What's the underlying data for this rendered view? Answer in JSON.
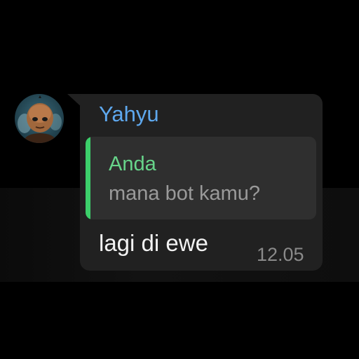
{
  "message": {
    "sender_name": "Yahyu",
    "avatar_icon": "profile-photo-icon",
    "reply": {
      "author": "Anda",
      "text": "mana bot kamu?"
    },
    "text": "lagi di ewe",
    "time": "12.05"
  },
  "colors": {
    "background": "#000000",
    "bubble": "#212121",
    "reply_background": "#2f2f2f",
    "sender_name": "#5ea8ee",
    "reply_accent": "#3ccf6a",
    "reply_author": "#67d48a",
    "reply_text": "#9a9a9a",
    "message_text": "#f2f2f2",
    "timestamp": "#8a8a8a"
  }
}
